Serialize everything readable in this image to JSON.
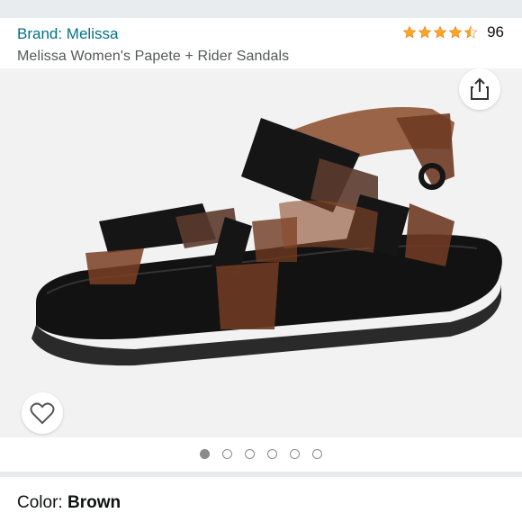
{
  "brand": {
    "link_text": "Brand: Melissa"
  },
  "rating": {
    "stars": 4.5,
    "count": "96",
    "star_color": "#ffa41c"
  },
  "product": {
    "title": "Melissa Women's Papete + Rider Sandals"
  },
  "icons": {
    "share": "share-icon",
    "favorite": "heart-icon"
  },
  "carousel": {
    "total": 6,
    "active_index": 0
  },
  "color": {
    "label": "Color: ",
    "value": "Brown"
  },
  "colors": {
    "link": "#007185",
    "text": "#0f1111",
    "secondary_text": "#565959",
    "image_bg": "#f2f2f2"
  }
}
